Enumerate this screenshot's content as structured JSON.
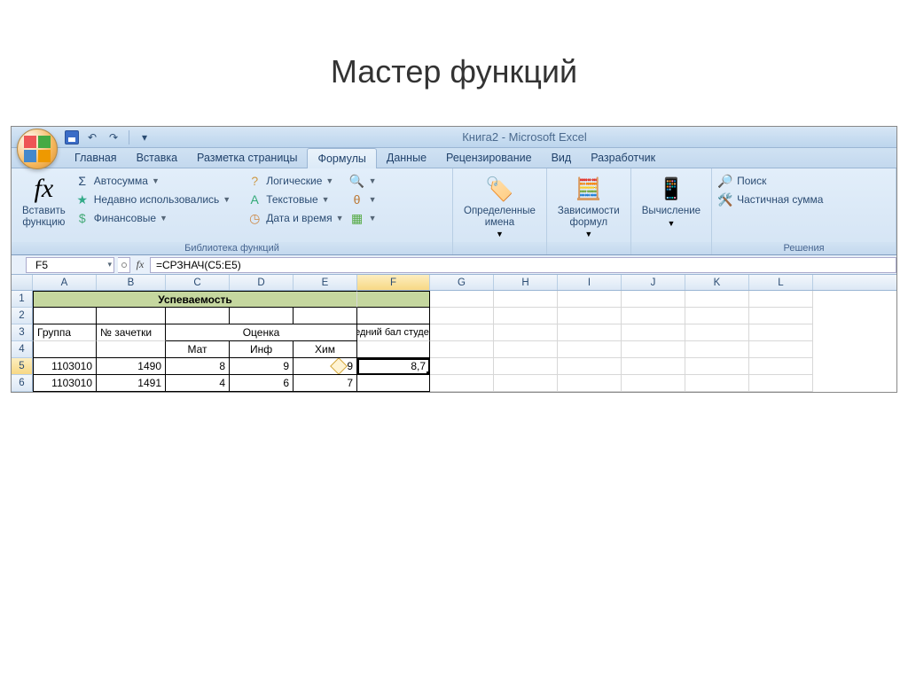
{
  "slide": {
    "title": "Мастер функций"
  },
  "app": {
    "title": "Книга2 - Microsoft Excel"
  },
  "tabs": {
    "home": "Главная",
    "insert": "Вставка",
    "layout": "Разметка страницы",
    "formulas": "Формулы",
    "data": "Данные",
    "review": "Рецензирование",
    "view": "Вид",
    "developer": "Разработчик"
  },
  "ribbon": {
    "insert_fn": "Вставить\nфункцию",
    "autosum": "Автосумма",
    "recent": "Недавно использовались",
    "financial": "Финансовые",
    "logical": "Логические",
    "text": "Текстовые",
    "datetime": "Дата и время",
    "defined_names": "Определенные\nимена",
    "formula_deps": "Зависимости\nформул",
    "calculation": "Вычисление",
    "search": "Поиск",
    "partial_sum": "Частичная сумма",
    "group_library": "Библиотека функций",
    "group_solutions": "Решения"
  },
  "formula_bar": {
    "namebox": "F5",
    "formula": "=СРЗНАЧ(C5:E5)"
  },
  "columns": [
    "A",
    "B",
    "C",
    "D",
    "E",
    "F",
    "G",
    "H",
    "I",
    "J",
    "K",
    "L"
  ],
  "active_col": "F",
  "active_row": 5,
  "sheet": {
    "title_row": "Успеваемость",
    "hdr_group": "Группа",
    "hdr_zach": "№ зачетки",
    "hdr_grade": "Оценка",
    "hdr_avg_big": "Средний бал студента",
    "hdr_mat": "Мат",
    "hdr_inf": "Инф",
    "hdr_chem": "Хим",
    "r5": {
      "A": "1103010",
      "B": "1490",
      "C": "8",
      "D": "9",
      "E": "9",
      "F": "8,7"
    },
    "r6": {
      "A": "1103010",
      "B": "1491",
      "C": "4",
      "D": "6",
      "E": "7"
    }
  },
  "chart_data": {
    "type": "table",
    "title": "Успеваемость",
    "columns": [
      "Группа",
      "№ зачетки",
      "Мат",
      "Инф",
      "Хим",
      "Средний бал студента"
    ],
    "rows": [
      [
        "1103010",
        1490,
        8,
        9,
        9,
        8.7
      ],
      [
        "1103010",
        1491,
        4,
        6,
        7,
        null
      ]
    ]
  }
}
